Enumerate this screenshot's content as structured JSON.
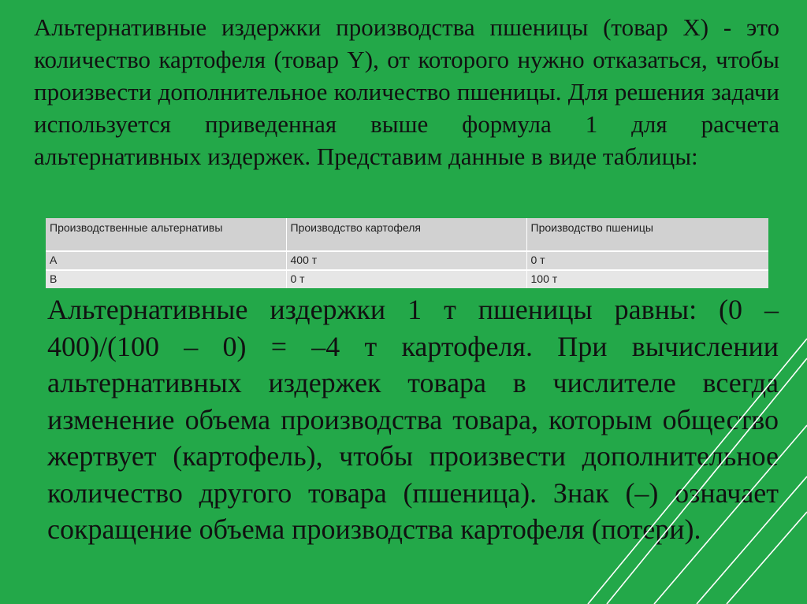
{
  "slide": {
    "paragraph1": "Альтернативные издержки производства пшеницы (товар X) - это количество картофеля (товар Y), от которого нужно отказаться, чтобы произвести дополнительное количество пшеницы. Для решения задачи используется приведенная выше формула 1 для расчета альтернативных издержек. Представим данные в виде таблицы:",
    "table": {
      "headers": [
        "Производственные альтернативы",
        "Производство картофеля",
        "Производство пшеницы"
      ],
      "rows": [
        [
          "А",
          "400 т",
          "0 т"
        ],
        [
          "В",
          "0 т",
          "100 т"
        ]
      ]
    },
    "paragraph2": "Альтернативные издержки 1 т пшеницы равны: (0 – 400)/(100 – 0) = –4 т картофеля. При вычислении альтернативных издержек товара в числителе всегда изменение объема производства товара, которым общество жертвует (картофель), чтобы произвести дополнительное количество другого товара (пшеница). Знак (–) означает сокращение объема производства картофеля (потери)."
  },
  "colors": {
    "background": "#23a849",
    "text": "#111111",
    "table_header": "#d1d1d1",
    "table_row": "#d9d9d9",
    "table_row_alt": "#e6e6e6",
    "decor_lines": "#ffffff"
  }
}
